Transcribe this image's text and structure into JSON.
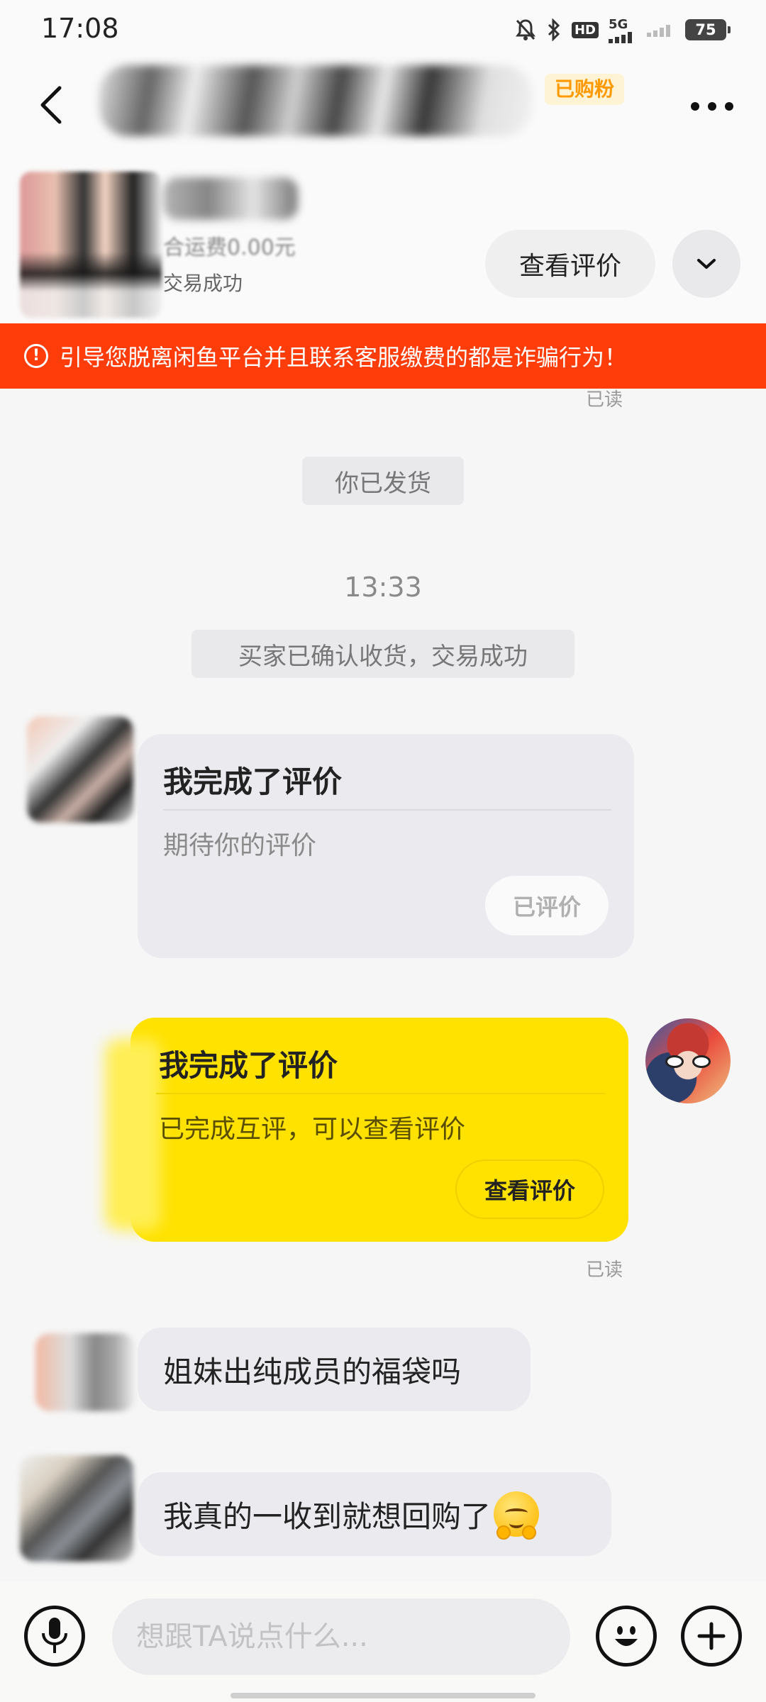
{
  "status_bar": {
    "time": "17:08",
    "hd_label": "HD",
    "network_label": "5G",
    "battery_level": "75"
  },
  "header": {
    "buyer_tag": "已购粉"
  },
  "product": {
    "price_text": "合运费0.00元",
    "status_text": "交易成功",
    "view_review_label": "查看评价"
  },
  "warning": {
    "text": "引导您脱离闲鱼平台并且联系客服缴费的都是诈骗行为！",
    "color": "#ff3d0a"
  },
  "chat": {
    "read_label": "已读",
    "shipped_notice": "你已发货",
    "timestamp": "13:33",
    "confirmed_notice": "买家已确认收货，交易成功",
    "incoming_review_card": {
      "title": "我完成了评价",
      "subtitle": "期待你的评价",
      "button_label": "已评价"
    },
    "outgoing_review_card": {
      "title": "我完成了评价",
      "subtitle": "已完成互评，可以查看评价",
      "button_label": "查看评价",
      "color": "#ffe200"
    },
    "messages": [
      {
        "text": "姐妹出纯成员的福袋吗"
      },
      {
        "text": "我真的一收到就想回购了",
        "emoji": "hugging-face"
      }
    ]
  },
  "input_bar": {
    "placeholder": "想跟TA说点什么..."
  },
  "icons": {
    "back": "chevron-left-icon",
    "more": "more-dots-icon",
    "expand": "chevron-down-icon",
    "warning": "exclamation-circle-icon",
    "voice": "microphone-icon",
    "emoji": "smiley-icon",
    "add": "plus-icon"
  }
}
